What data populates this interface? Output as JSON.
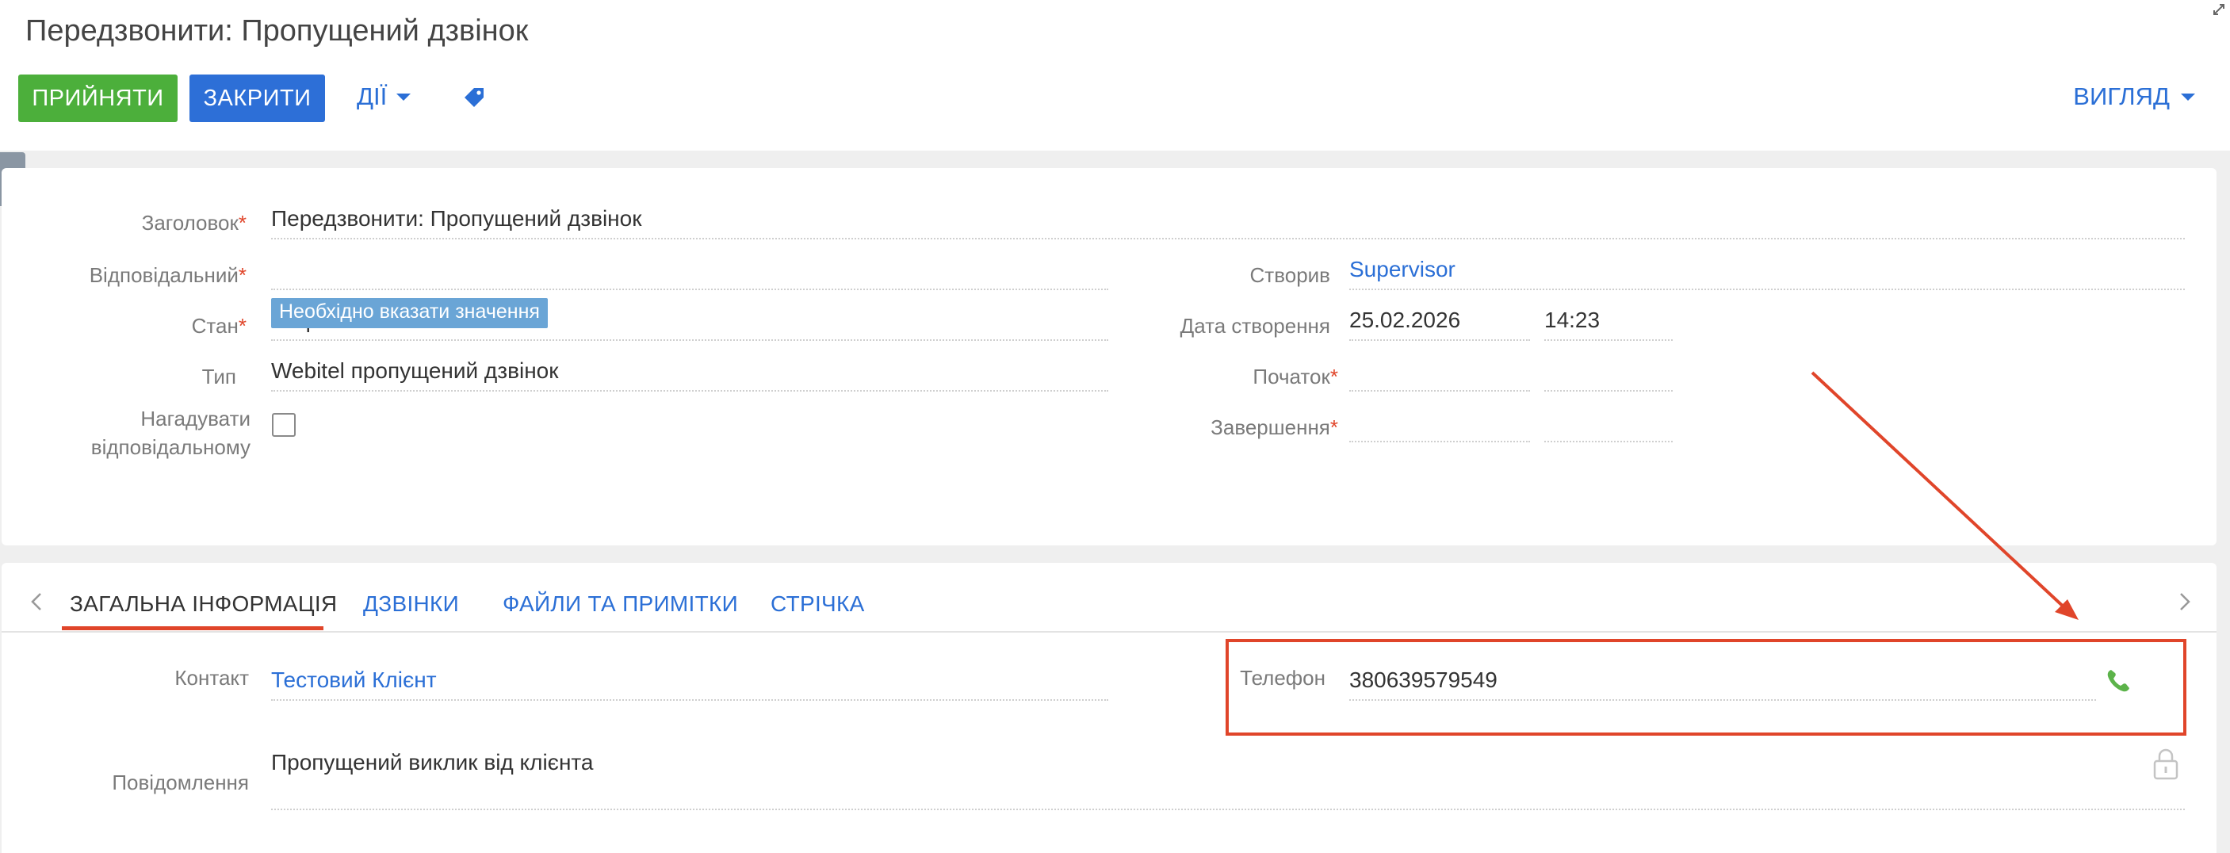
{
  "header": {
    "title": "Передзвонити: Пропущений дзвінок",
    "accept_label": "ПРИЙНЯТИ",
    "close_label": "ЗАКРИТИ",
    "actions_label": "ДІЇ",
    "view_label": "ВИГЛЯД"
  },
  "form": {
    "title_label": "Заголовок",
    "title_value": "Передзвонити: Пропущений дзвінок",
    "owner_label": "Відповідальний",
    "owner_value": "",
    "status_label": "Стан",
    "status_value": "Не розпочата",
    "validation_tooltip": "Необхідно вказати значення",
    "type_label": "Тип",
    "type_value": "Webitel пропущений дзвінок",
    "remind_label_line1": "Нагадувати",
    "remind_label_line2": "відповідальному",
    "remind_checked": false,
    "created_by_label": "Створив",
    "created_by_value": "Supervisor",
    "created_date_label": "Дата створення",
    "created_date_value": "25.02.2026",
    "created_time_value": "14:23",
    "start_label": "Початок",
    "end_label": "Завершення"
  },
  "tabs": [
    {
      "label": "ЗАГАЛЬНА ІНФОРМАЦІЯ",
      "active": true
    },
    {
      "label": "ДЗВІНКИ",
      "active": false
    },
    {
      "label": "ФАЙЛИ ТА ПРИМІТКИ",
      "active": false
    },
    {
      "label": "СТРІЧКА",
      "active": false
    }
  ],
  "general": {
    "contact_label": "Контакт",
    "contact_value": "Тестовий Клієнт",
    "phone_label": "Телефон",
    "phone_value": "380639579549",
    "message_label": "Повідомлення",
    "message_value": "Пропущений виклик від клієнта"
  },
  "colors": {
    "accept": "#4caf3b",
    "close": "#2d6fd7",
    "link": "#2b6fd6",
    "required": "#e0452a",
    "annotation": "#e0452a",
    "phone_icon": "#5cb34a"
  },
  "icons": [
    "expand-icon",
    "tag-icon",
    "chevron-right-icon",
    "chevron-left-icon",
    "phone-icon",
    "lock-icon"
  ]
}
